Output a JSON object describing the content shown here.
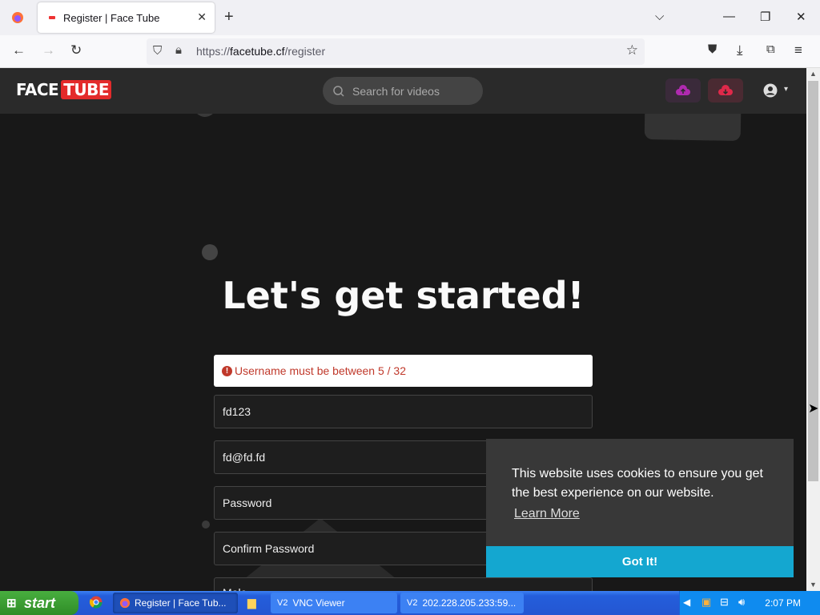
{
  "browser": {
    "tab_title": "Register | Face Tube",
    "url_prefix": "https://",
    "url_domain": "facetube.cf",
    "url_path": "/register"
  },
  "site": {
    "logo_face": "FACE",
    "logo_tube": "TUBE",
    "search_placeholder": "Search for videos"
  },
  "form": {
    "heading": "Let's get started!",
    "error": "Username must be between 5 / 32",
    "username": "fd123",
    "email": "fd@fd.fd",
    "password_placeholder": "Password",
    "confirm_placeholder": "Confirm Password",
    "gender_partial": "Male"
  },
  "cookie": {
    "message": "This website uses cookies to ensure you get the best experience on our website.",
    "learn_more": "Learn More",
    "button": "Got It!"
  },
  "taskbar": {
    "start": "start",
    "items": [
      "Register | Face Tub...",
      "VNC Viewer",
      "202.228.205.233:59..."
    ],
    "clock": "2:07 PM"
  },
  "colors": {
    "accent_red": "#e32b2b",
    "cookie_button": "#14a7d0",
    "upload_purple": "#b02ab0",
    "upload_red": "#e0294a"
  }
}
